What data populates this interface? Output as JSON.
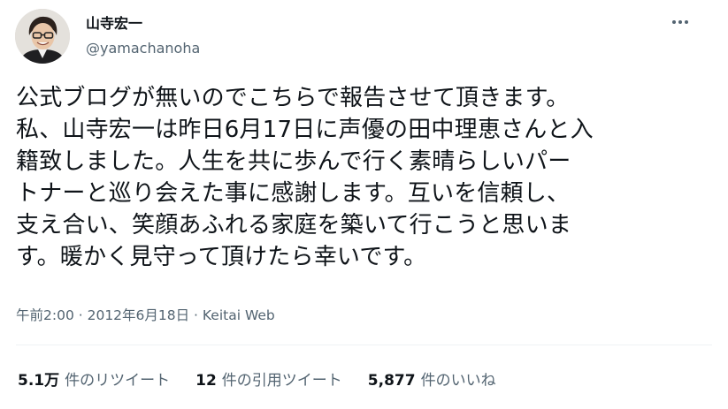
{
  "user": {
    "display_name": "山寺宏一",
    "handle": "@yamachanoha"
  },
  "tweet": {
    "lines": [
      "公式ブログが無いのでこちらで報告させて頂きます。",
      "私、山寺宏一は昨日6月17日に声優の田中理恵さんと入",
      "籍致しました。人生を共に歩んで行く素晴らしいパー",
      "トナーと巡り会えた事に感謝します。互いを信頼し、",
      "支え合い、笑顔あふれる家庭を築いて行こうと思いま",
      "す。暖かく見守って頂けたら幸いです。"
    ]
  },
  "meta": {
    "time": "午前2:00",
    "separator1": " · ",
    "date": "2012年6月18日",
    "separator2": " · ",
    "source": "Keitai Web"
  },
  "stats": [
    {
      "value": "5.1万",
      "label": "件のリツイート"
    },
    {
      "value": "12",
      "label": "件の引用ツイート"
    },
    {
      "value": "5,877",
      "label": "件のいいね"
    }
  ],
  "icons": {
    "more": "more-horizontal-icon"
  }
}
